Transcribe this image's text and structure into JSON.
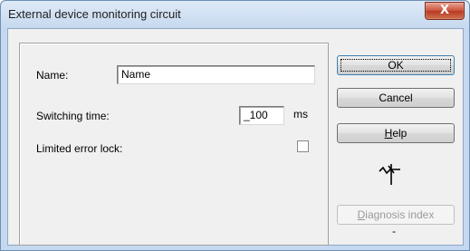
{
  "window": {
    "title": "External device monitoring circuit",
    "close_glyph": "X"
  },
  "form": {
    "name_label": "Name:",
    "name_value": "Name",
    "switching_time_label": "Switching time:",
    "switching_time_value": "_100",
    "switching_time_unit": "ms",
    "limited_error_lock_label": "Limited error lock:",
    "limited_error_lock_checked": false
  },
  "buttons": {
    "ok": "OK",
    "cancel": "Cancel",
    "help_first": "H",
    "help_rest": "elp",
    "diagnosis_first": "D",
    "diagnosis_rest": "iagnosis index",
    "diagnosis_enabled": false
  },
  "status": {
    "dash": "-"
  },
  "icons": {
    "function_symbol": "edm-circuit-icon"
  }
}
